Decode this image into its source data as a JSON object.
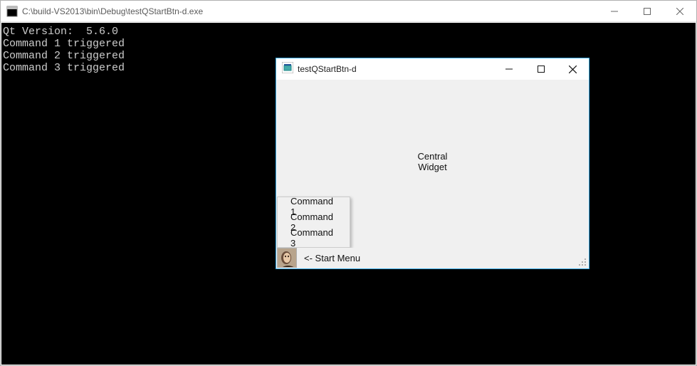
{
  "outer_window": {
    "title": "C:\\build-VS2013\\bin\\Debug\\testQStartBtn-d.exe",
    "controls": {
      "minimize": "minimize",
      "maximize": "maximize",
      "close": "close"
    }
  },
  "console_lines": [
    "Qt Version:  5.6.0",
    "Command 1 triggered",
    "Command 2 triggered",
    "Command 3 triggered"
  ],
  "child_window": {
    "title": "testQStartBtn-d",
    "controls": {
      "minimize": "minimize",
      "maximize": "maximize",
      "close": "close"
    },
    "central_label_l1": "Central",
    "central_label_l2": "Widget",
    "status_text": "<- Start Menu",
    "start_icon": "avatar-icon",
    "menu_items": [
      "Command 1",
      "Command 2",
      "Command 3"
    ]
  }
}
